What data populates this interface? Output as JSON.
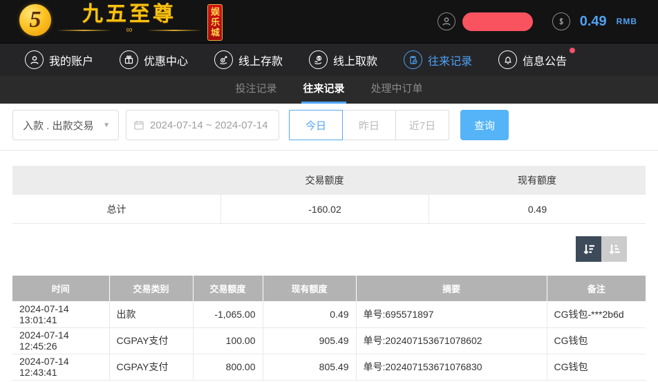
{
  "header": {
    "logo": {
      "emblem": "5",
      "title": "九五至尊",
      "badge": "娱乐城",
      "knot": "∞"
    },
    "user": {
      "balance": "0.49",
      "currency": "RMB"
    }
  },
  "nav": {
    "items": [
      {
        "label": "我的账户",
        "icon": "user-icon",
        "active": false
      },
      {
        "label": "优惠中心",
        "icon": "gift-icon",
        "active": false
      },
      {
        "label": "线上存款",
        "icon": "deposit-icon",
        "active": false
      },
      {
        "label": "线上取款",
        "icon": "withdraw-icon",
        "active": false
      },
      {
        "label": "往来记录",
        "icon": "records-icon",
        "active": true
      },
      {
        "label": "信息公告",
        "icon": "bell-icon",
        "active": false,
        "notification_dot": true
      }
    ]
  },
  "subtabs": [
    {
      "label": "投注记录",
      "active": false
    },
    {
      "label": "往来记录",
      "active": true
    },
    {
      "label": "处理中订单",
      "active": false
    }
  ],
  "filters": {
    "type_select_value": "入款 . 出款交易",
    "date_range_value": "2024-07-14 ~ 2024-07-14",
    "quick_today": "今日",
    "quick_yesterday": "昨日",
    "quick_week": "近7日",
    "active_quick": "今日",
    "search_label": "查询"
  },
  "summary": {
    "headers": {
      "col1": "",
      "col2": "交易额度",
      "col3": "现有额度"
    },
    "total_row": {
      "label": "总计",
      "amount": "-160.02",
      "balance": "0.49"
    }
  },
  "table": {
    "headers": [
      "时间",
      "交易类别",
      "交易额度",
      "现有额度",
      "摘要",
      "备注"
    ],
    "rows": [
      [
        "2024-07-14 13:01:41",
        "出款",
        "-1,065.00",
        "0.49",
        "单号:695571897",
        "CG钱包-***2b6d"
      ],
      [
        "2024-07-14 12:45:26",
        "CGPAY支付",
        "100.00",
        "905.49",
        "单号:202407153671078602",
        "CG钱包"
      ],
      [
        "2024-07-14 12:43:41",
        "CGPAY支付",
        "800.00",
        "805.49",
        "单号:202407153671076830",
        "CG钱包"
      ]
    ]
  },
  "colors": {
    "accent_blue": "#4da3f5",
    "search_button_blue": "#54b4f7",
    "notification_red": "#f4516c",
    "redaction_red": "#fa5360",
    "logo_gold": "#f6c211",
    "badge_red": "#c41414",
    "table_header_gray": "#b3b3b3",
    "sort_dark": "#3c4a5a",
    "sort_light": "#cccccc"
  }
}
